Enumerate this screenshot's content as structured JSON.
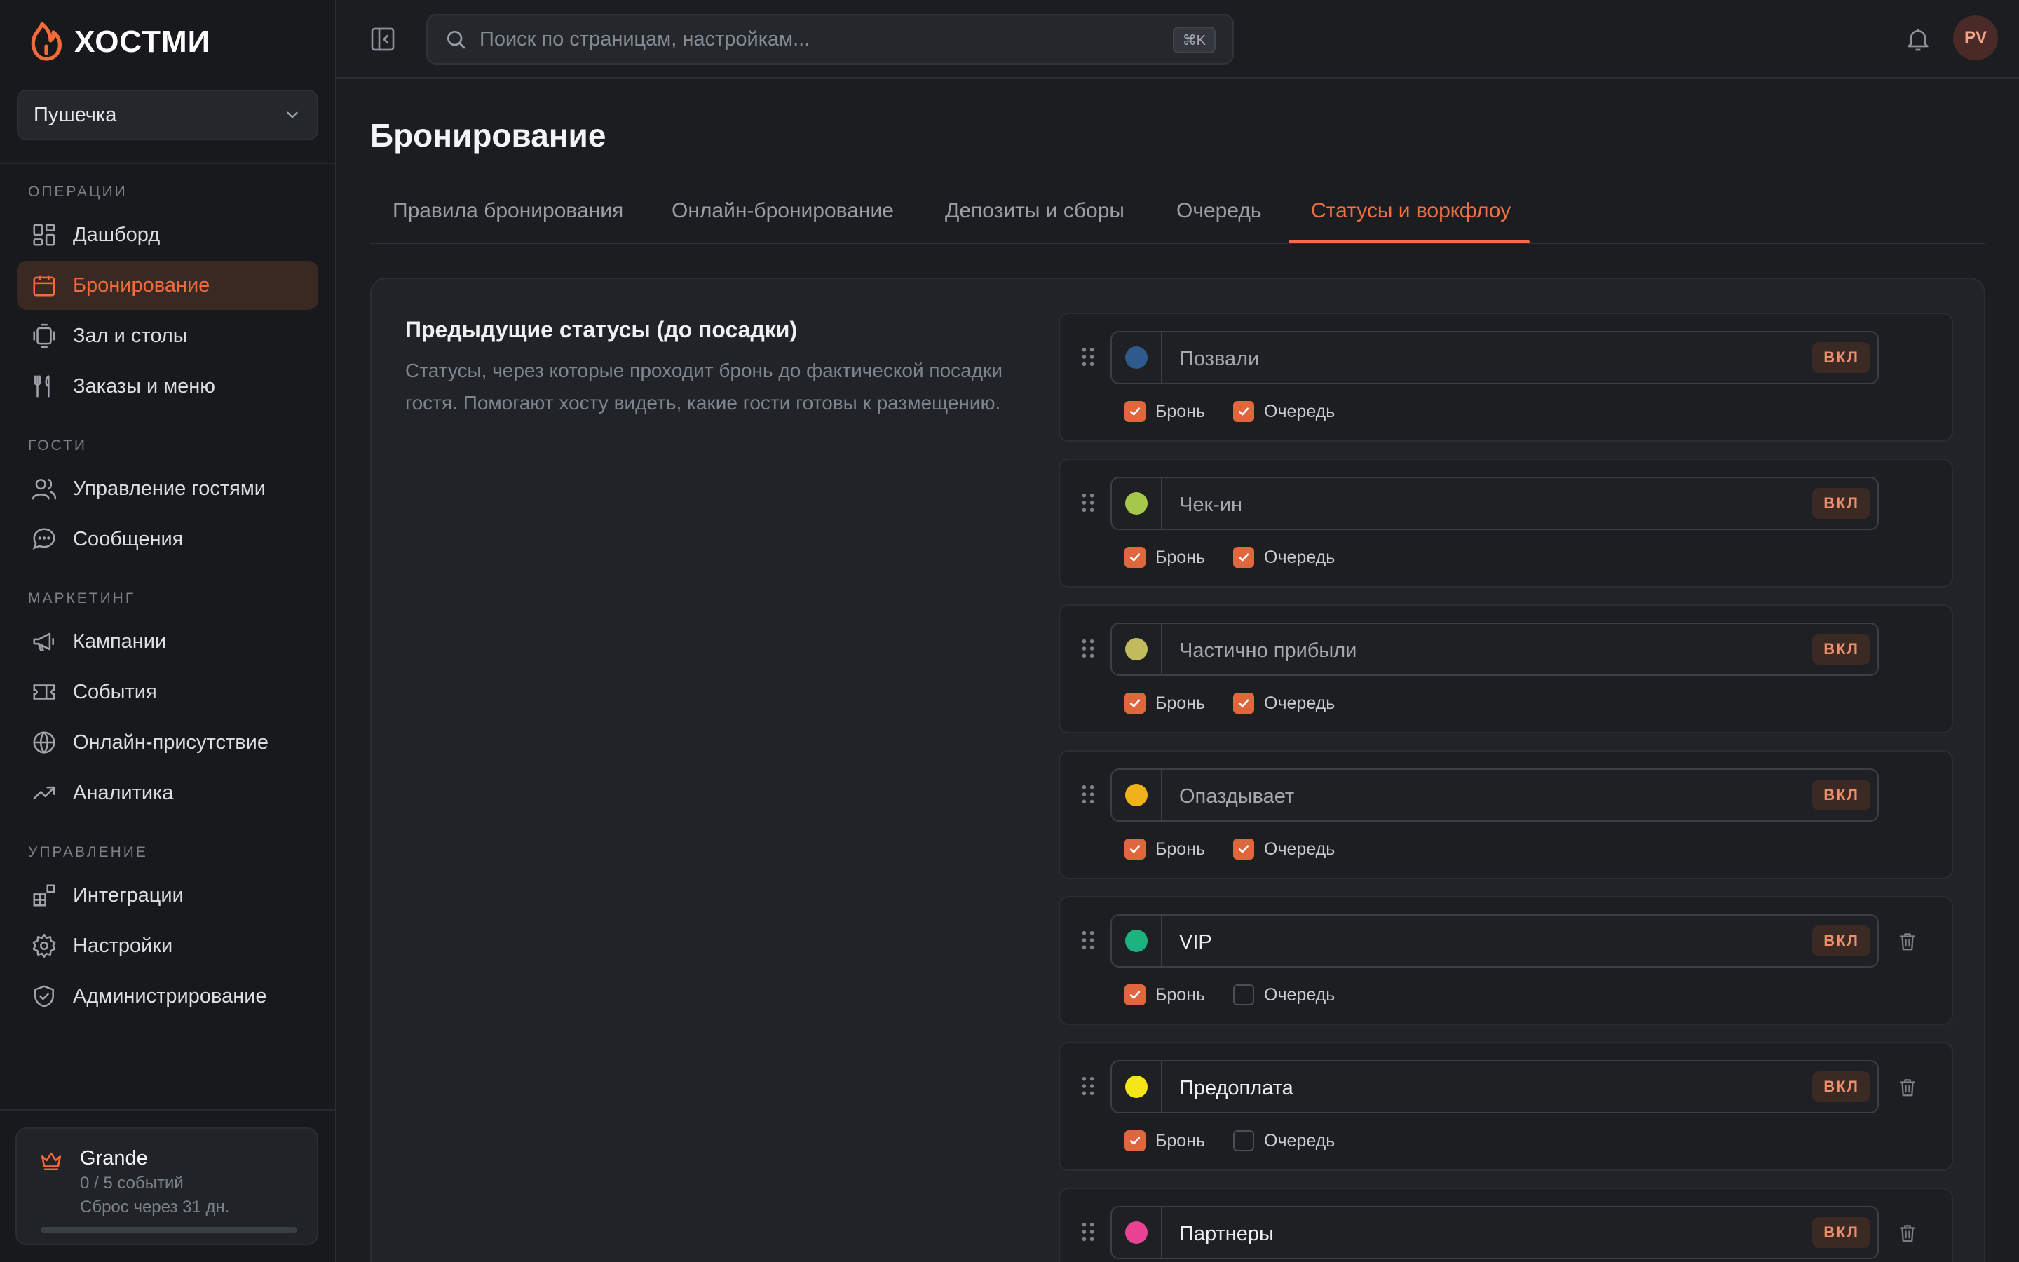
{
  "brand": {
    "name": "ХОСТМИ",
    "accent": "#f26b3a"
  },
  "venue": {
    "name": "Пушечка"
  },
  "sidebar": {
    "sections": [
      {
        "label": "ОПЕРАЦИИ",
        "items": [
          {
            "label": "Дашборд",
            "icon": "dashboard-icon"
          },
          {
            "label": "Бронирование",
            "icon": "calendar-icon",
            "active": true
          },
          {
            "label": "Зал и столы",
            "icon": "tables-icon"
          },
          {
            "label": "Заказы и меню",
            "icon": "utensils-icon"
          }
        ]
      },
      {
        "label": "ГОСТИ",
        "items": [
          {
            "label": "Управление гостями",
            "icon": "users-icon"
          },
          {
            "label": "Сообщения",
            "icon": "chat-icon"
          }
        ]
      },
      {
        "label": "МАРКЕТИНГ",
        "items": [
          {
            "label": "Кампании",
            "icon": "megaphone-icon"
          },
          {
            "label": "События",
            "icon": "ticket-icon"
          },
          {
            "label": "Онлайн-присутствие",
            "icon": "globe-icon"
          },
          {
            "label": "Аналитика",
            "icon": "trend-icon"
          }
        ]
      },
      {
        "label": "УПРАВЛЕНИЕ",
        "items": [
          {
            "label": "Интеграции",
            "icon": "integrations-icon"
          },
          {
            "label": "Настройки",
            "icon": "gear-icon"
          },
          {
            "label": "Администрирование",
            "icon": "shield-icon"
          }
        ]
      }
    ]
  },
  "plan": {
    "name": "Grande",
    "usage": "0 / 5 событий",
    "reset": "Сброс через 31 дн.",
    "progress": 0
  },
  "search": {
    "placeholder": "Поиск по страницам, настройкам...",
    "shortcut": "⌘K"
  },
  "user": {
    "initials": "PV"
  },
  "page": {
    "title": "Бронирование",
    "tabs": [
      {
        "label": "Правила бронирования"
      },
      {
        "label": "Онлайн-бронирование"
      },
      {
        "label": "Депозиты и сборы"
      },
      {
        "label": "Очередь"
      },
      {
        "label": "Статусы и воркфлоу",
        "active": true
      }
    ]
  },
  "section": {
    "title": "Предыдущие статусы (до посадки)",
    "description": "Статусы, через которые проходит бронь до фактической посадки гостя. Помогают хосту видеть, какие гости готовы к размещению."
  },
  "toggle_label": "ВКЛ",
  "check_labels": {
    "booking": "Бронь",
    "queue": "Очередь"
  },
  "statuses": [
    {
      "name": "Позвали",
      "color": "#2e5a8e",
      "booking": true,
      "queue": true,
      "deletable": false,
      "custom": false
    },
    {
      "name": "Чек-ин",
      "color": "#a6c84a",
      "booking": true,
      "queue": true,
      "deletable": false,
      "custom": false
    },
    {
      "name": "Частично прибыли",
      "color": "#c2bb5e",
      "booking": true,
      "queue": true,
      "deletable": false,
      "custom": false
    },
    {
      "name": "Опаздывает",
      "color": "#f0b21c",
      "booking": true,
      "queue": true,
      "deletable": false,
      "custom": false
    },
    {
      "name": "VIP",
      "color": "#1db37e",
      "booking": true,
      "queue": false,
      "deletable": true,
      "custom": true
    },
    {
      "name": "Предоплата",
      "color": "#f5e61a",
      "booking": true,
      "queue": false,
      "deletable": true,
      "custom": true
    },
    {
      "name": "Партнеры",
      "color": "#e84393",
      "booking": true,
      "queue": false,
      "deletable": true,
      "custom": true
    }
  ]
}
